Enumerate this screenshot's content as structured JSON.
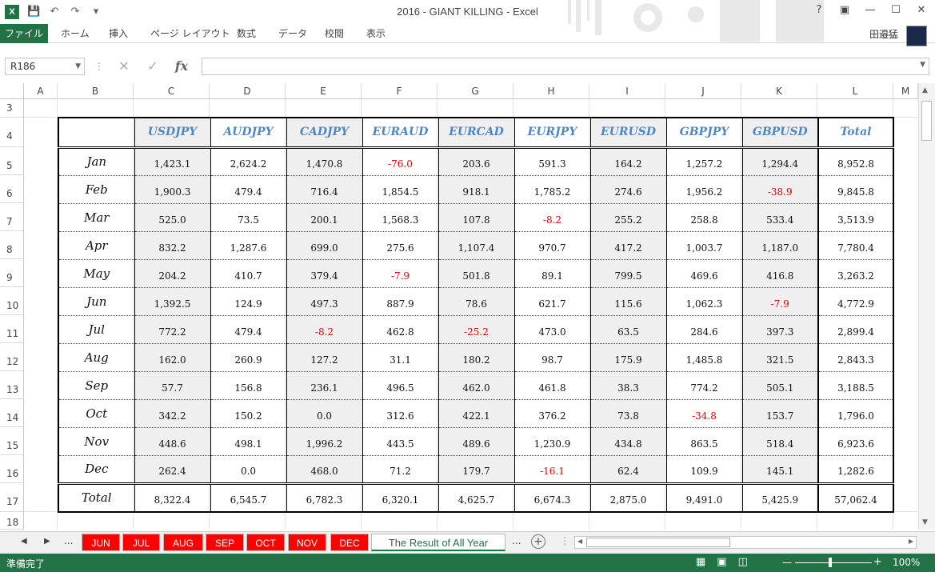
{
  "window": {
    "title": "2016 - GIANT KILLING - Excel",
    "user": "田邉猛"
  },
  "ribbon": {
    "tabs": [
      "ファイル",
      "ホーム",
      "挿入",
      "ページ レイアウト",
      "数式",
      "データ",
      "校閲",
      "表示"
    ]
  },
  "formula_bar": {
    "name_box": "R186",
    "fx": "fx",
    "value": ""
  },
  "columns": [
    "A",
    "B",
    "C",
    "D",
    "E",
    "F",
    "G",
    "H",
    "I",
    "J",
    "K",
    "L",
    "M"
  ],
  "rows": [
    "3",
    "4",
    "5",
    "6",
    "7",
    "8",
    "9",
    "10",
    "11",
    "12",
    "13",
    "14",
    "15",
    "16",
    "17",
    "18"
  ],
  "table": {
    "headers": [
      "USDJPY",
      "AUDJPY",
      "CADJPY",
      "EURAUD",
      "EURCAD",
      "EURJPY",
      "EURUSD",
      "GBPJPY",
      "GBPUSD",
      "Total"
    ],
    "rows": [
      {
        "label": "Jan",
        "values": [
          "1,423.1",
          "2,624.2",
          "1,470.8",
          "-76.0",
          "203.6",
          "591.3",
          "164.2",
          "1,257.2",
          "1,294.4",
          "8,952.8"
        ]
      },
      {
        "label": "Feb",
        "values": [
          "1,900.3",
          "479.4",
          "716.4",
          "1,854.5",
          "918.1",
          "1,785.2",
          "274.6",
          "1,956.2",
          "-38.9",
          "9,845.8"
        ]
      },
      {
        "label": "Mar",
        "values": [
          "525.0",
          "73.5",
          "200.1",
          "1,568.3",
          "107.8",
          "-8.2",
          "255.2",
          "258.8",
          "533.4",
          "3,513.9"
        ]
      },
      {
        "label": "Apr",
        "values": [
          "832.2",
          "1,287.6",
          "699.0",
          "275.6",
          "1,107.4",
          "970.7",
          "417.2",
          "1,003.7",
          "1,187.0",
          "7,780.4"
        ]
      },
      {
        "label": "May",
        "values": [
          "204.2",
          "410.7",
          "379.4",
          "-7.9",
          "501.8",
          "89.1",
          "799.5",
          "469.6",
          "416.8",
          "3,263.2"
        ]
      },
      {
        "label": "Jun",
        "values": [
          "1,392.5",
          "124.9",
          "497.3",
          "887.9",
          "78.6",
          "621.7",
          "115.6",
          "1,062.3",
          "-7.9",
          "4,772.9"
        ]
      },
      {
        "label": "Jul",
        "values": [
          "772.2",
          "479.4",
          "-8.2",
          "462.8",
          "-25.2",
          "473.0",
          "63.5",
          "284.6",
          "397.3",
          "2,899.4"
        ]
      },
      {
        "label": "Aug",
        "values": [
          "162.0",
          "260.9",
          "127.2",
          "31.1",
          "180.2",
          "98.7",
          "175.9",
          "1,485.8",
          "321.5",
          "2,843.3"
        ]
      },
      {
        "label": "Sep",
        "values": [
          "57.7",
          "156.8",
          "236.1",
          "496.5",
          "462.0",
          "461.8",
          "38.3",
          "774.2",
          "505.1",
          "3,188.5"
        ]
      },
      {
        "label": "Oct",
        "values": [
          "342.2",
          "150.2",
          "0.0",
          "312.6",
          "422.1",
          "376.2",
          "73.8",
          "-34.8",
          "153.7",
          "1,796.0"
        ]
      },
      {
        "label": "Nov",
        "values": [
          "448.6",
          "498.1",
          "1,996.2",
          "443.5",
          "489.6",
          "1,230.9",
          "434.8",
          "863.5",
          "518.4",
          "6,923.6"
        ]
      },
      {
        "label": "Dec",
        "values": [
          "262.4",
          "0.0",
          "468.0",
          "71.2",
          "179.7",
          "-16.1",
          "62.4",
          "109.9",
          "145.1",
          "1,282.6"
        ]
      }
    ],
    "total": {
      "label": "Total",
      "values": [
        "8,322.4",
        "6,545.7",
        "6,782.3",
        "6,320.1",
        "4,625.7",
        "6,674.3",
        "2,875.0",
        "9,491.0",
        "5,425.9",
        "57,062.4"
      ]
    }
  },
  "sheet_tabs": {
    "ellipsis": "...",
    "items": [
      "JUN",
      "JUL",
      "AUG",
      "SEP",
      "OCT",
      "NOV",
      "DEC"
    ],
    "active": "The Result of All Year",
    "ellipsis_right": "..."
  },
  "status": {
    "ready": "準備完了",
    "zoom": "100%"
  },
  "colors": {
    "excel_green": "#217346",
    "header_blue": "#4f86c6",
    "negative_red": "#e00000",
    "tab_red": "#ff0000"
  }
}
